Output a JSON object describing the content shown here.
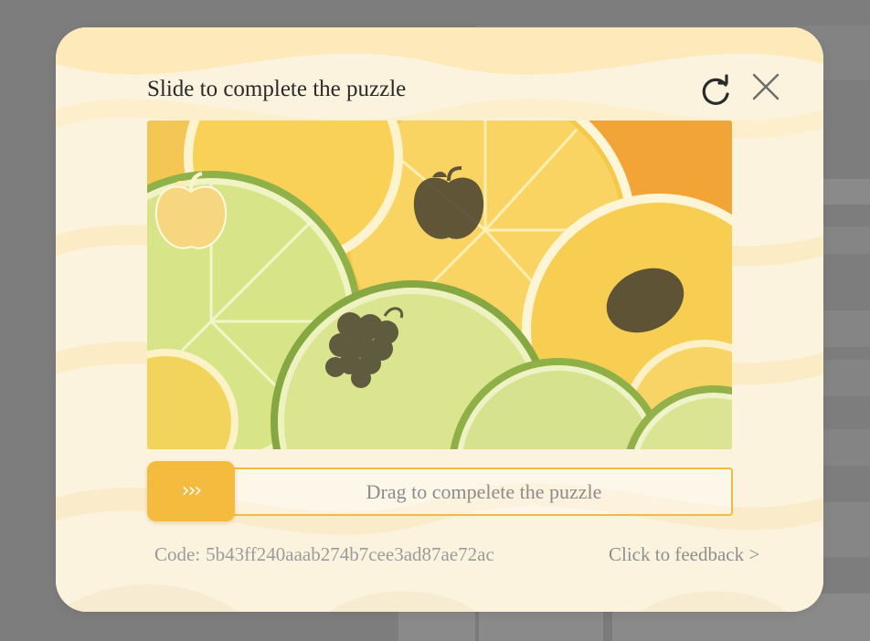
{
  "modal": {
    "title": "Slide to complete the puzzle",
    "refresh_icon": "refresh-icon",
    "close_icon": "close-icon"
  },
  "puzzle": {
    "image_description_icon": "lemon-slices-image",
    "piece_shape": "apple",
    "hole_shapes": [
      "apple",
      "grapes",
      "lemon"
    ]
  },
  "slider": {
    "handle_label": "›››",
    "hint": "Drag to compelete the puzzle",
    "progress": 0
  },
  "footer": {
    "code_label": "Code:",
    "code_value": "5b43ff240aaab274b7cee3ad87ae72ac",
    "feedback_link": "Click to feedback >"
  },
  "colors": {
    "accent": "#f5bb3e",
    "modal_bg": "#fbf3de",
    "overlay": "#7d7d7d"
  }
}
